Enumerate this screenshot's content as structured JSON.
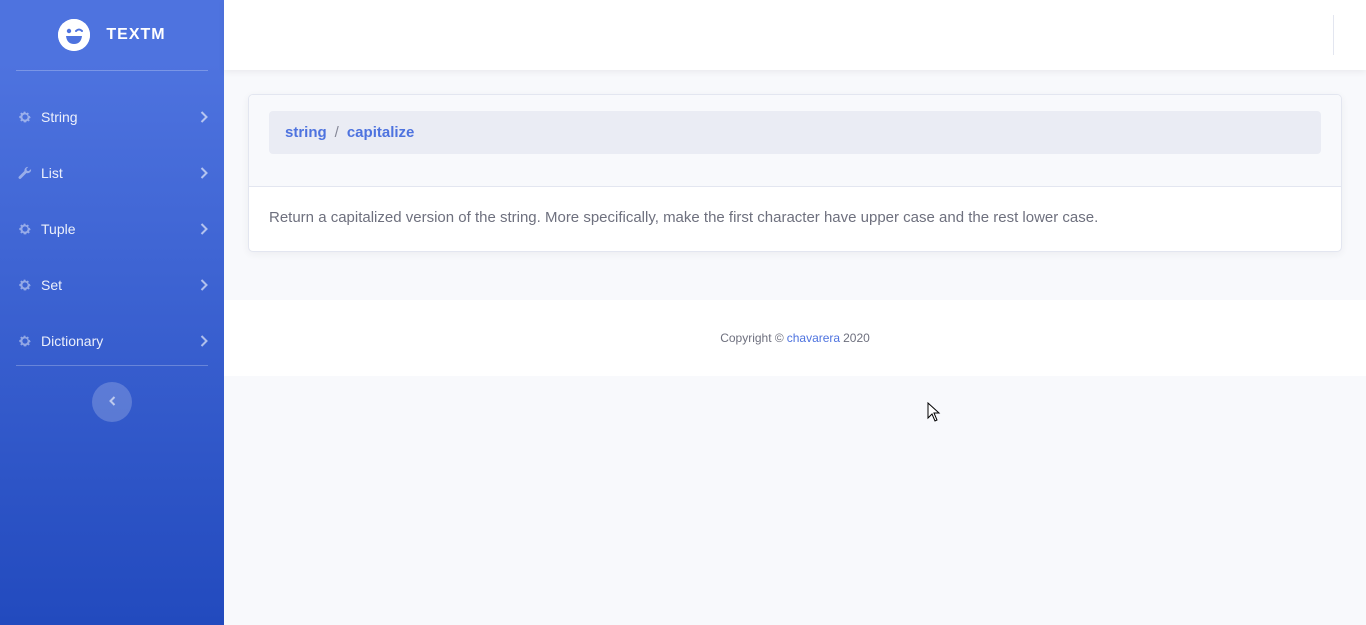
{
  "sidebar": {
    "brand": "TEXTM",
    "items": [
      {
        "label": "String",
        "icon": "gear-icon"
      },
      {
        "label": "List",
        "icon": "wrench-icon"
      },
      {
        "label": "Tuple",
        "icon": "gear-icon"
      },
      {
        "label": "Set",
        "icon": "gear-icon"
      },
      {
        "label": "Dictionary",
        "icon": "gear-icon"
      }
    ]
  },
  "breadcrumb": {
    "root": "string",
    "separator": "/",
    "current": "capitalize"
  },
  "content": {
    "description": "Return a capitalized version of the string. More specifically, make the first character have upper case and the rest lower case."
  },
  "footer": {
    "prefix": "Copyright ©",
    "author": "chavarera",
    "year": "2020"
  },
  "colors": {
    "primary": "#4e73df",
    "sidebar_gradient_end": "#224abe"
  }
}
